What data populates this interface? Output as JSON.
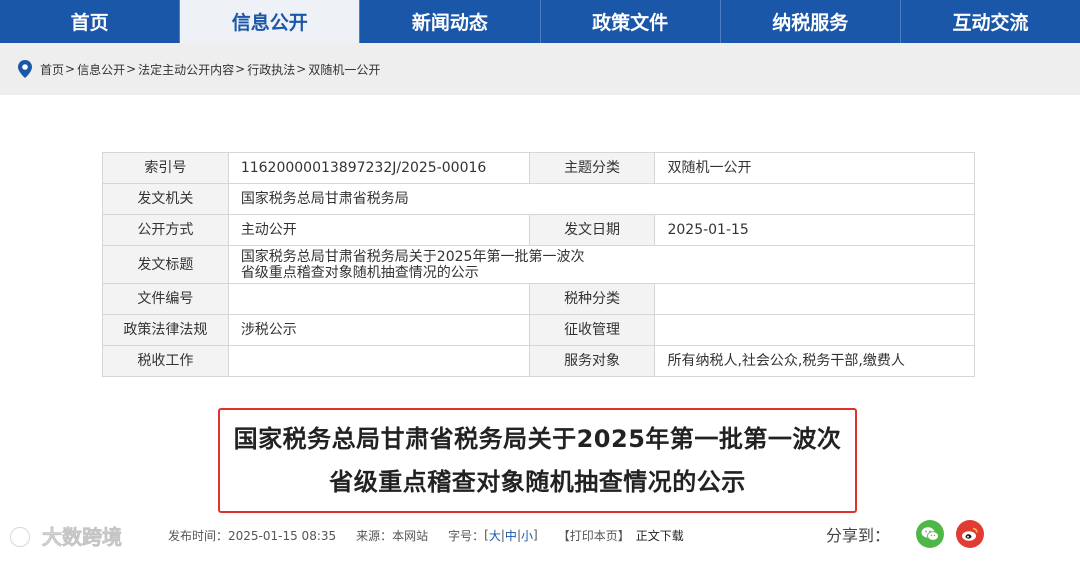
{
  "nav": {
    "items": [
      {
        "label": "首页",
        "active": false
      },
      {
        "label": "信息公开",
        "active": true
      },
      {
        "label": "新闻动态",
        "active": false
      },
      {
        "label": "政策文件",
        "active": false
      },
      {
        "label": "纳税服务",
        "active": false
      },
      {
        "label": "互动交流",
        "active": false
      }
    ]
  },
  "breadcrumb": {
    "items": [
      "首页",
      "信息公开",
      "法定主动公开内容",
      "行政执法",
      "双随机一公开"
    ],
    "separator": ">"
  },
  "meta": {
    "index_label": "索引号",
    "index_value": "11620000013897232J/2025-00016",
    "topic_label": "主题分类",
    "topic_value": "双随机一公开",
    "issuer_label": "发文机关",
    "issuer_value": "国家税务总局甘肃省税务局",
    "method_label": "公开方式",
    "method_value": "主动公开",
    "date_label": "发文日期",
    "date_value": "2025-01-15",
    "title_label": "发文标题",
    "title_line1": "国家税务总局甘肃省税务局关于2025年第一批第一波次",
    "title_line2": "省级重点稽查对象随机抽查情况的公示",
    "docno_label": "文件编号",
    "docno_value": "",
    "taxtype_label": "税种分类",
    "taxtype_value": "",
    "policy_label": "政策法律法规",
    "policy_value": "涉税公示",
    "collection_label": "征收管理",
    "collection_value": "",
    "taxwork_label": "税收工作",
    "taxwork_value": "",
    "audience_label": "服务对象",
    "audience_value": "所有纳税人,社会公众,税务干部,缴费人"
  },
  "article": {
    "title_line1": "国家税务总局甘肃省税务局关于2025年第一批第一波次",
    "title_line2": "省级重点稽查对象随机抽查情况的公示"
  },
  "info": {
    "published": "发布时间：2025-01-15 08:35",
    "source": "来源：本网站",
    "font_size_label": "字号：",
    "size_large": "大",
    "size_medium": "中",
    "size_small": "小",
    "print": "【打印本页】",
    "download": "正文下载"
  },
  "share": {
    "label": "分享到："
  },
  "colors": {
    "nav": "#1b57a8",
    "accent_red": "#e0322d",
    "wechat": "#4fb648",
    "weibo": "#e23b33"
  },
  "icons": [
    "location-pin-icon",
    "wechat-icon",
    "weibo-icon"
  ]
}
